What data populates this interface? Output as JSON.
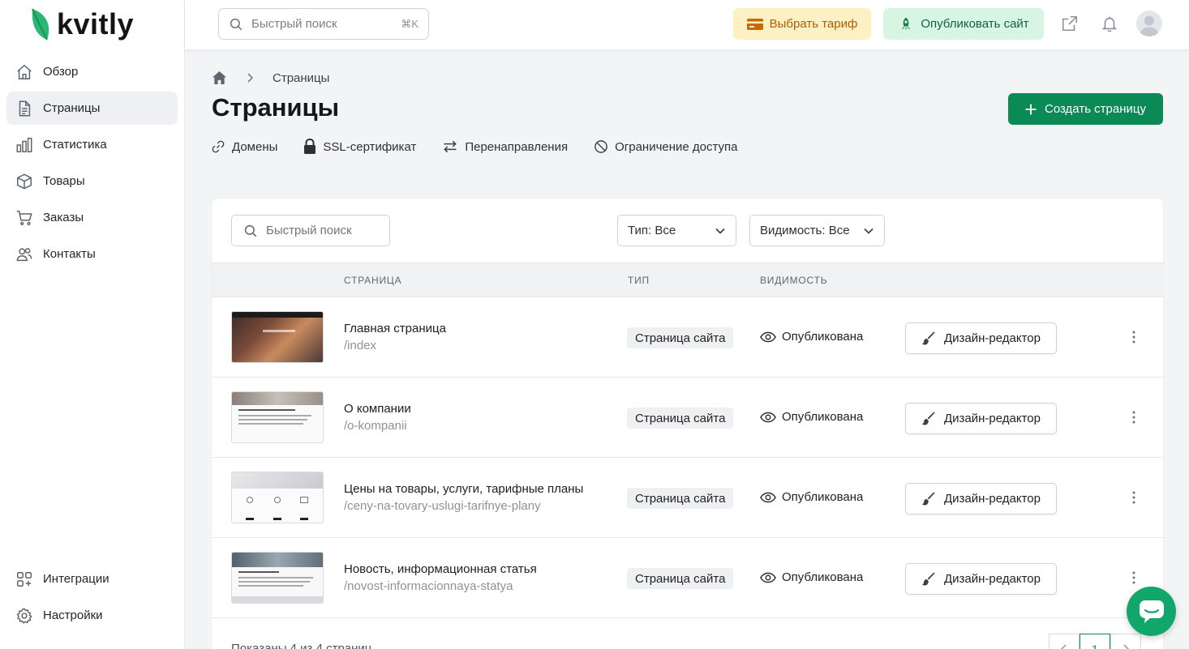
{
  "app": {
    "logo_text": "kvitly"
  },
  "sidebar": {
    "items": [
      {
        "label": "Обзор",
        "icon": "home-icon"
      },
      {
        "label": "Страницы",
        "icon": "document-icon",
        "active": true
      },
      {
        "label": "Статистика",
        "icon": "bar-chart-icon"
      },
      {
        "label": "Товары",
        "icon": "box-icon"
      },
      {
        "label": "Заказы",
        "icon": "cart-icon"
      },
      {
        "label": "Контакты",
        "icon": "users-icon"
      }
    ],
    "bottom_items": [
      {
        "label": "Интеграции",
        "icon": "integrations-icon"
      },
      {
        "label": "Настройки",
        "icon": "gear-icon"
      }
    ]
  },
  "topbar": {
    "search_placeholder": "Быстрый поиск",
    "search_shortcut": "⌘K",
    "tariff_label": "Выбрать тариф",
    "publish_label": "Опубликовать сайт"
  },
  "breadcrumb": {
    "current": "Страницы"
  },
  "page": {
    "title": "Страницы",
    "create_label": "Создать страницу"
  },
  "subnav": [
    {
      "label": "Домены",
      "icon": "link-icon"
    },
    {
      "label": "SSL-сертификат",
      "icon": "lock-icon"
    },
    {
      "label": "Перенаправления",
      "icon": "redirect-icon"
    },
    {
      "label": "Ограничение доступа",
      "icon": "block-icon"
    }
  ],
  "filters": {
    "search_placeholder": "Быстрый поиск",
    "type_label": "Тип: Все",
    "visibility_label": "Видимость: Все"
  },
  "table": {
    "columns": [
      "СТРАНИЦА",
      "ТИП",
      "ВИДИМОСТЬ"
    ],
    "rows": [
      {
        "title": "Главная страница",
        "slug": "/index",
        "type": "Страница сайта",
        "visibility": "Опубликована",
        "action": "Дизайн-редактор"
      },
      {
        "title": "О компании",
        "slug": "/o-kompanii",
        "type": "Страница сайта",
        "visibility": "Опубликована",
        "action": "Дизайн-редактор"
      },
      {
        "title": "Цены на товары, услуги, тарифные планы",
        "slug": "/ceny-na-tovary-uslugi-tarifnye-plany",
        "type": "Страница сайта",
        "visibility": "Опубликована",
        "action": "Дизайн-редактор"
      },
      {
        "title": "Новость, информационная статья",
        "slug": "/novost-informacionnaya-statya",
        "type": "Страница сайта",
        "visibility": "Опубликована",
        "action": "Дизайн-редактор"
      }
    ]
  },
  "footer": {
    "summary": "Показаны 4 из 4 страниц",
    "current_page": "1"
  },
  "colors": {
    "brand_green": "#0b8a55",
    "tariff_bg": "#fdf0c4",
    "publish_bg": "#d6f5e3",
    "chat_green": "#12a76a"
  }
}
